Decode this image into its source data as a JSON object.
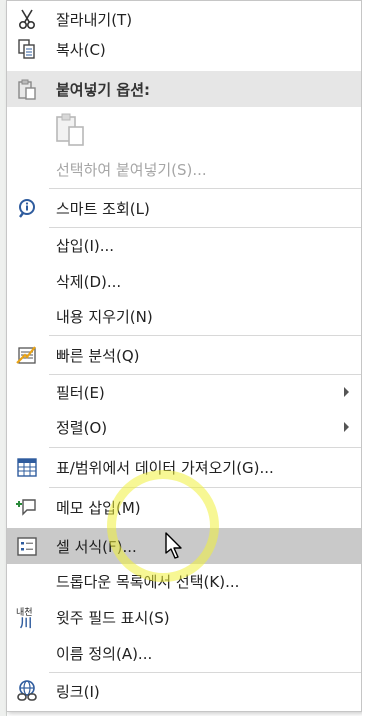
{
  "menu": {
    "items": [
      {
        "id": "cut",
        "label": "잘라내기(T)",
        "icon": "scissors-icon"
      },
      {
        "id": "copy",
        "label": "복사(C)",
        "icon": "copy-icon"
      },
      {
        "id": "paste_options",
        "label": "붙여넣기 옵션:",
        "icon": "clipboard-icon"
      },
      {
        "id": "paste_special",
        "label": "선택하여 붙여넣기(S)..."
      },
      {
        "id": "smart_lookup",
        "label": "스마트 조회(L)",
        "icon": "smart-lookup-icon"
      },
      {
        "id": "insert",
        "label": "삽입(I)..."
      },
      {
        "id": "delete",
        "label": "삭제(D)..."
      },
      {
        "id": "clear_contents",
        "label": "내용 지우기(N)"
      },
      {
        "id": "quick_analysis",
        "label": "빠른 분석(Q)",
        "icon": "quick-analysis-icon"
      },
      {
        "id": "filter",
        "label": "필터(E)",
        "submenu": true
      },
      {
        "id": "sort",
        "label": "정렬(O)",
        "submenu": true
      },
      {
        "id": "get_data",
        "label": "표/범위에서 데이터 가져오기(G)...",
        "icon": "table-icon"
      },
      {
        "id": "insert_comment",
        "label": "메모 삽입(M)",
        "icon": "comment-icon"
      },
      {
        "id": "format_cells",
        "label": "셀 서식(F)...",
        "icon": "format-cells-icon",
        "highlighted": true
      },
      {
        "id": "pick_from_list",
        "label": "드롭다운 목록에서 선택(K)..."
      },
      {
        "id": "phonetic",
        "label": "윗주 필드 표시(S)",
        "icon": "phonetic-icon",
        "icon_text": "내천\n川"
      },
      {
        "id": "define_name",
        "label": "이름 정의(A)..."
      },
      {
        "id": "link",
        "label": "링크(I)",
        "icon": "link-icon"
      }
    ]
  },
  "colors": {
    "highlight": "#c9c9c9",
    "section": "#e6e6e6",
    "disabled": "#a6a6a6",
    "icon_blue": "#2f5c9e"
  }
}
